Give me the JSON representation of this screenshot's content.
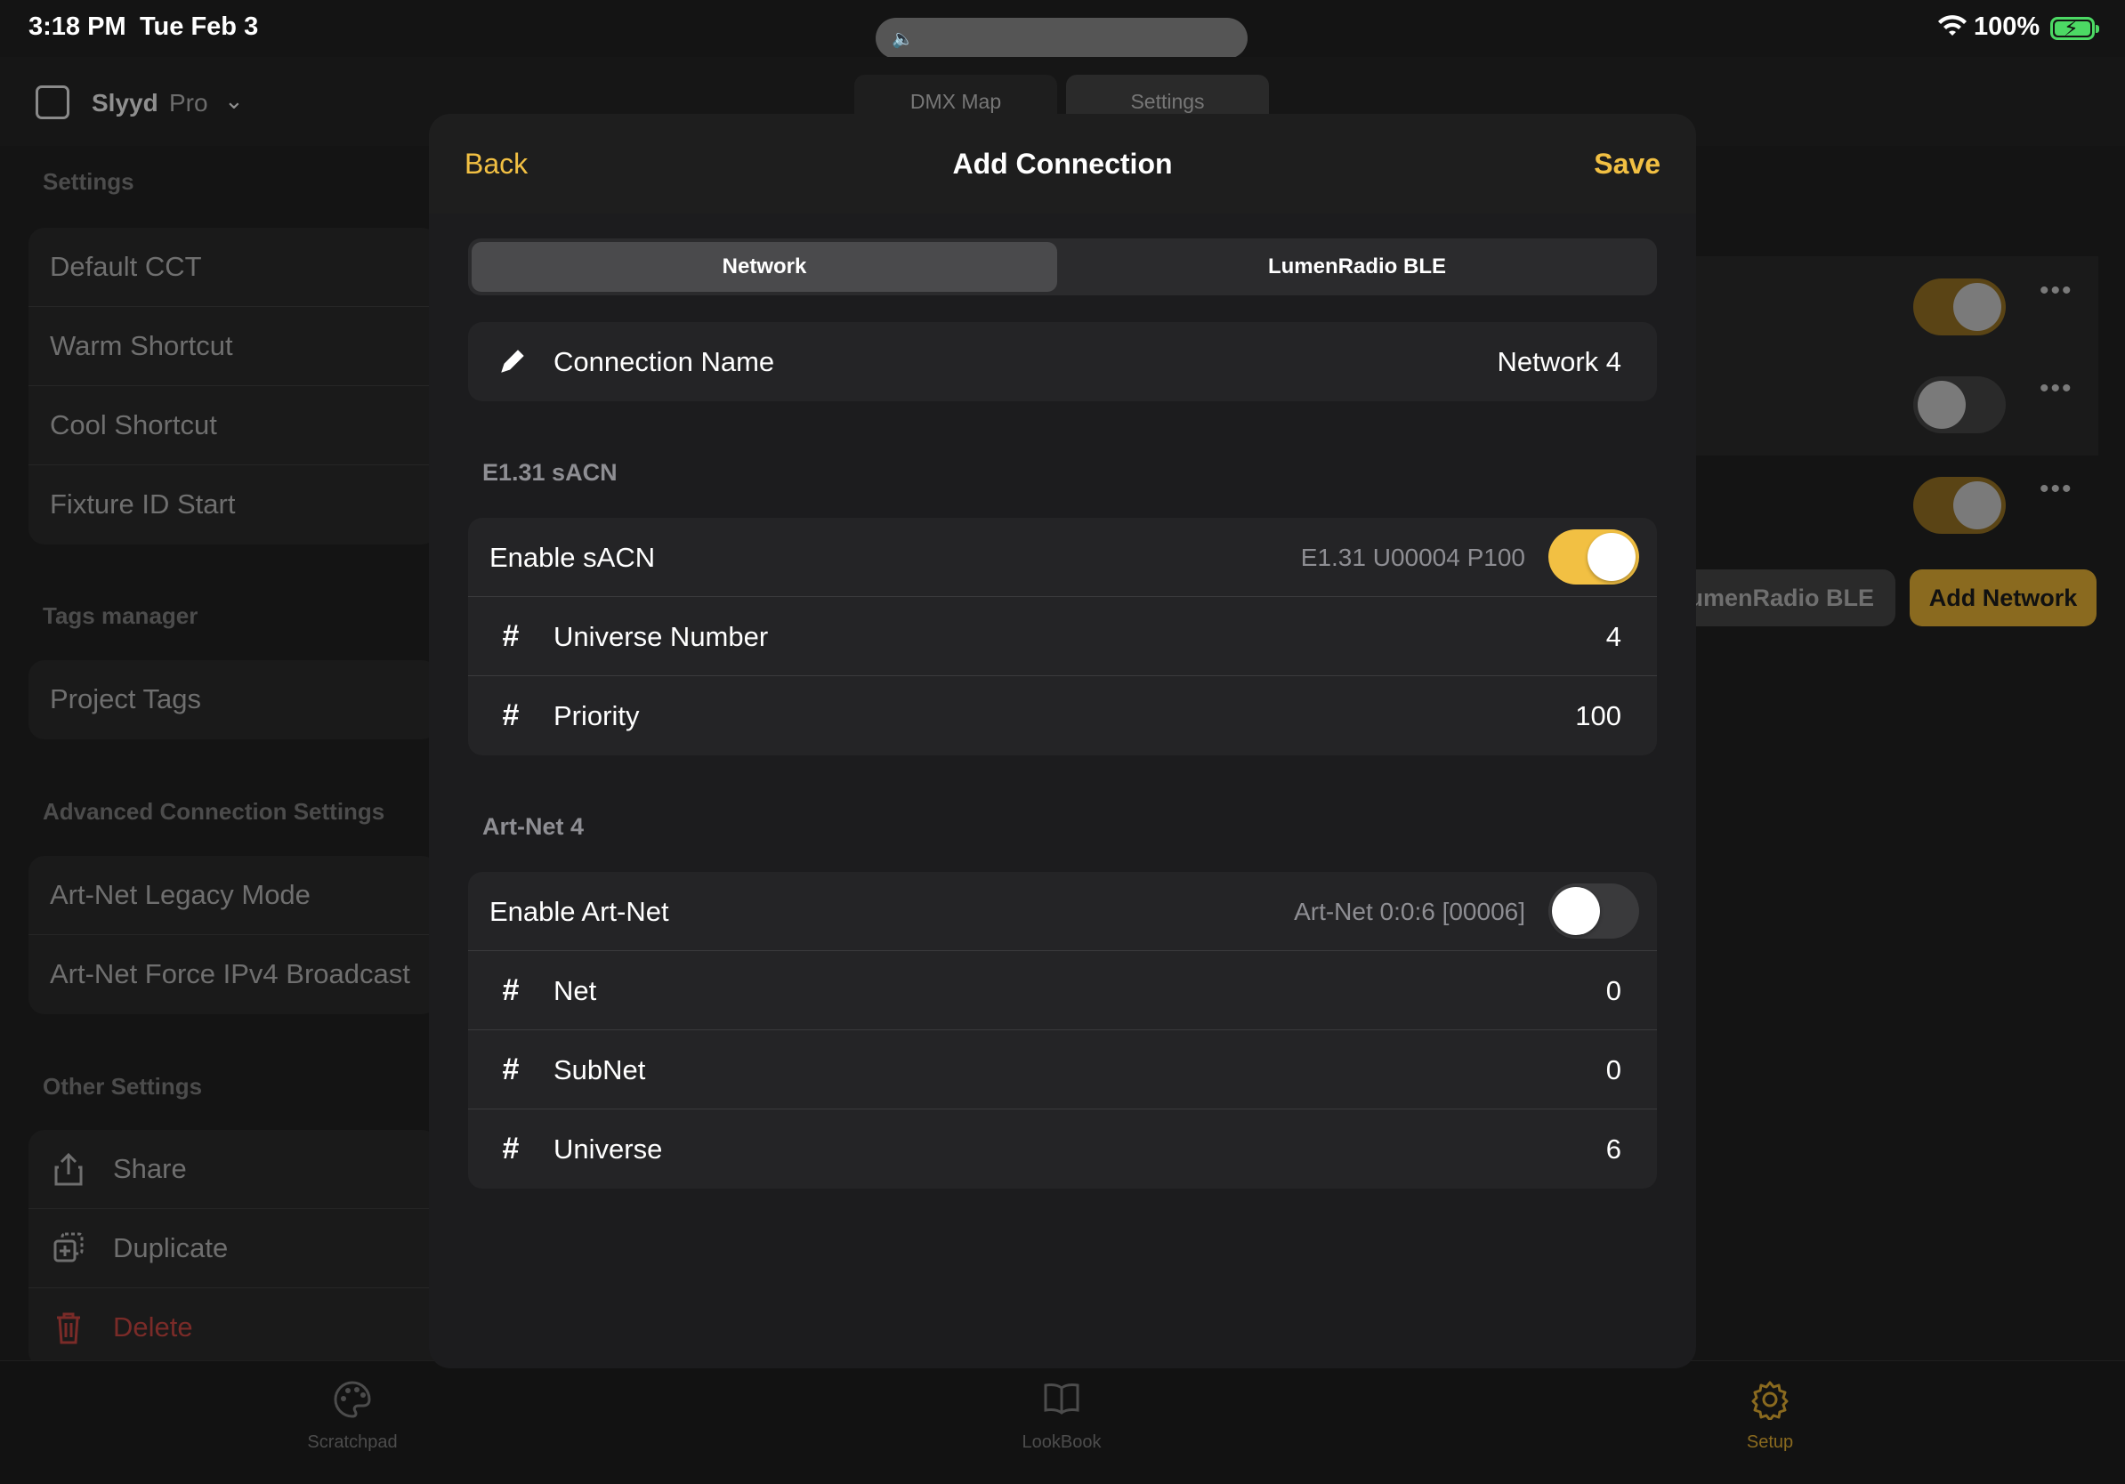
{
  "status_bar": {
    "time": "3:18 PM",
    "date": "Tue Feb 3",
    "battery_percent": "100%",
    "battery_color": "#4cd964"
  },
  "app": {
    "name": "Slyyd",
    "plan": "Pro",
    "top_tabs": [
      "DMX Map",
      "Settings"
    ]
  },
  "sidebar": {
    "settings_title": "Settings",
    "settings_items": [
      "Default CCT",
      "Warm Shortcut",
      "Cool Shortcut",
      "Fixture ID Start"
    ],
    "tags_title": "Tags manager",
    "tags_items": [
      "Project Tags"
    ],
    "advanced_title": "Advanced Connection Settings",
    "advanced_items": [
      "Art-Net Legacy Mode",
      "Art-Net Force IPv4 Broadcast"
    ],
    "other_title": "Other Settings",
    "other_items": [
      {
        "label": "Share",
        "icon": "share-icon"
      },
      {
        "label": "Duplicate",
        "icon": "duplicate-icon"
      },
      {
        "label": "Delete",
        "icon": "trash-icon",
        "color": "#7a2b28"
      }
    ]
  },
  "background_panel": {
    "toggles": [
      true,
      false,
      true
    ],
    "lumenradio_button": "LumenRadio BLE",
    "lumenradio_visible_text": "umenRadio BLE",
    "add_network_button": "Add Network",
    "accent_color": "#8a6a1f"
  },
  "tab_bar": {
    "items": [
      {
        "label": "Scratchpad",
        "icon": "palette-icon",
        "active": false
      },
      {
        "label": "LookBook",
        "icon": "book-icon",
        "active": false
      },
      {
        "label": "Setup",
        "icon": "gear-icon",
        "active": true
      }
    ]
  },
  "modal": {
    "back_label": "Back",
    "title": "Add Connection",
    "save_label": "Save",
    "accent_color": "#f2c043",
    "segments": [
      "Network",
      "LumenRadio BLE"
    ],
    "selected_segment": "Network",
    "connection_name_label": "Connection Name",
    "connection_name_value": "Network 4",
    "sacn": {
      "section_title": "E1.31 sACN",
      "enable_label": "Enable sACN",
      "enable_detail": "E1.31 U00004 P100",
      "enabled": true,
      "universe_label": "Universe Number",
      "universe_value": "4",
      "priority_label": "Priority",
      "priority_value": "100"
    },
    "artnet": {
      "section_title": "Art-Net 4",
      "enable_label": "Enable Art-Net",
      "enable_detail": "Art-Net 0:0:6 [00006]",
      "enabled": false,
      "net_label": "Net",
      "net_value": "0",
      "subnet_label": "SubNet",
      "subnet_value": "0",
      "universe_label": "Universe",
      "universe_value": "6"
    }
  }
}
